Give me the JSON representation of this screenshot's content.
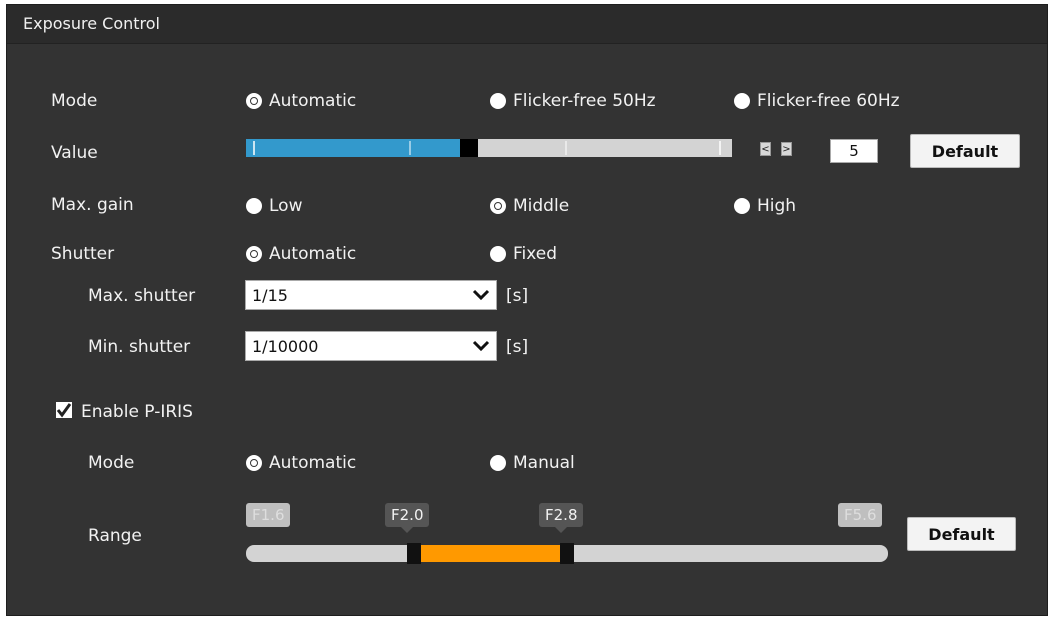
{
  "panel": {
    "title": "Exposure Control"
  },
  "mode": {
    "label": "Mode",
    "options": [
      "Automatic",
      "Flicker-free 50Hz",
      "Flicker-free 60Hz"
    ],
    "selected": "Automatic"
  },
  "value": {
    "label": "Value",
    "number": "5",
    "fill_fraction": 0.44,
    "prev_glyph": "<",
    "next_glyph": ">",
    "default_label": "Default",
    "fill_color": "#3399cc"
  },
  "max_gain": {
    "label": "Max. gain",
    "options": [
      "Low",
      "Middle",
      "High"
    ],
    "selected": "Middle"
  },
  "shutter": {
    "label": "Shutter",
    "options": [
      "Automatic",
      "Fixed"
    ],
    "selected": "Automatic",
    "max_label": "Max. shutter",
    "max_value": "1/15",
    "min_label": "Min. shutter",
    "min_value": "1/10000",
    "unit": "[s]"
  },
  "piris": {
    "enable_label": "Enable P-IRIS",
    "enabled": true,
    "mode_label": "Mode",
    "mode_options": [
      "Automatic",
      "Manual"
    ],
    "mode_selected": "Automatic",
    "range_label": "Range",
    "range_stops": [
      "F1.6",
      "F2.0",
      "F2.8",
      "F5.6"
    ],
    "range_selected": [
      "F2.0",
      "F2.8"
    ],
    "range_color": "#ff9900",
    "default_label": "Default"
  }
}
